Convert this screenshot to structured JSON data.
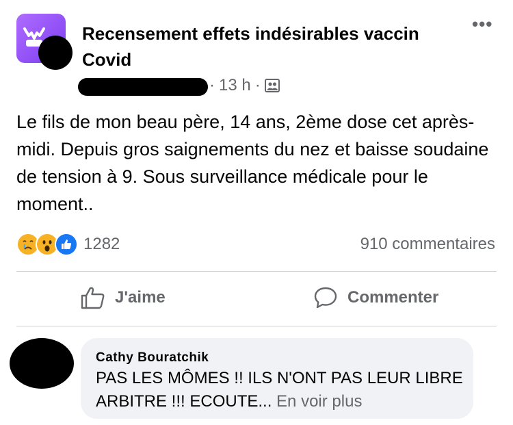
{
  "post": {
    "group_name": "Recensement effets indésirables vaccin Covid",
    "timestamp": "13 h",
    "separator": "·",
    "audience_icon": "group-members-icon",
    "more_label": "•••",
    "text": "Le fils de mon beau père, 14 ans, 2ème dose cet après-midi. Depuis gros saignements du nez et baisse soudaine de tension à 9. Sous surveillance médicale pour le moment..",
    "reaction_icons": [
      "sad-reaction-icon",
      "wow-reaction-icon",
      "like-reaction-icon"
    ],
    "reaction_count": "1282",
    "comments_count": "910 commentaires"
  },
  "actions": {
    "like_label": "J'aime",
    "comment_label": "Commenter"
  },
  "comment": {
    "author": "Cathy Bouratchik",
    "text": "PAS LES MÔMES !! ILS N'ONT PAS LEUR LIBRE ARBITRE !!! ECOUTE...",
    "see_more": "En voir plus"
  },
  "colors": {
    "text_primary": "#050505",
    "text_secondary": "#65676b",
    "bubble_bg": "#f0f2f5",
    "like_blue": "#1877f2",
    "reaction_yellow": "#f7b125",
    "group_purple": "#8a4af3"
  }
}
